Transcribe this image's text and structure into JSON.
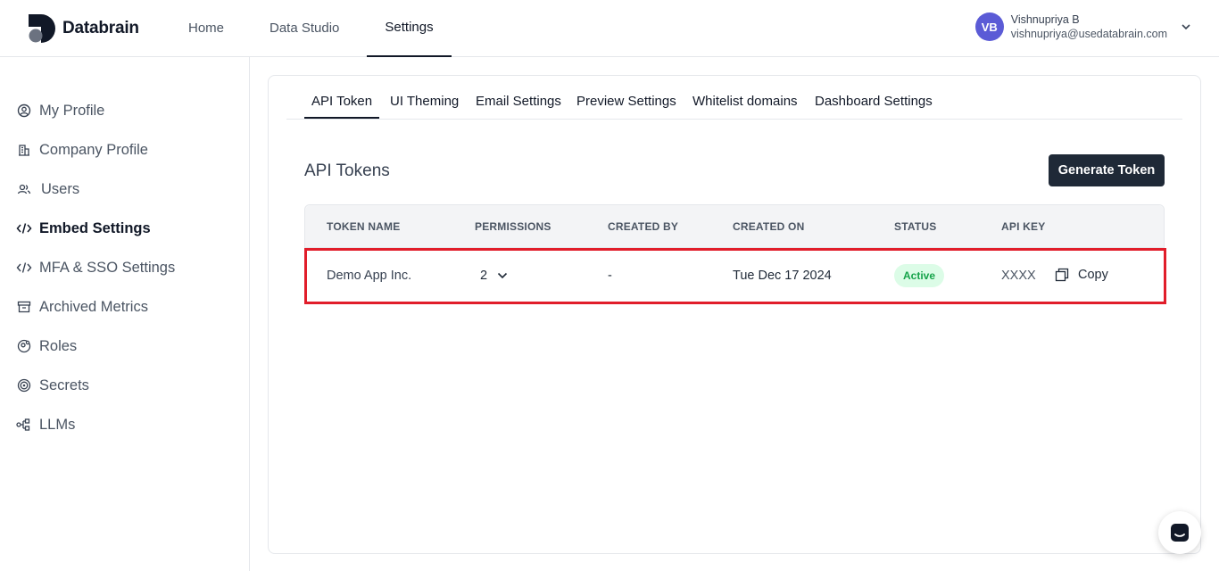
{
  "app": {
    "logo_text": "Databrain"
  },
  "topnav": [
    {
      "label": "Home"
    },
    {
      "label": "Data Studio"
    },
    {
      "label": "Settings"
    }
  ],
  "user": {
    "initials": "VB",
    "name": "Vishnupriya B",
    "email": "vishnupriya@usedatabrain.com"
  },
  "sidebar": {
    "items": [
      {
        "label": "My Profile",
        "icon": "user-circle-icon"
      },
      {
        "label": "Company Profile",
        "icon": "building-icon"
      },
      {
        "label": "Users",
        "icon": "users-icon"
      },
      {
        "label": "Embed Settings",
        "icon": "code-icon"
      },
      {
        "label": "MFA & SSO Settings",
        "icon": "code-icon"
      },
      {
        "label": "Archived Metrics",
        "icon": "archive-icon"
      },
      {
        "label": "Roles",
        "icon": "user-gear-icon"
      },
      {
        "label": "Secrets",
        "icon": "target-icon"
      },
      {
        "label": "LLMs",
        "icon": "nodes-icon"
      }
    ],
    "active": "Embed Settings"
  },
  "tabs": [
    {
      "label": "API Token"
    },
    {
      "label": "UI Theming"
    },
    {
      "label": "Email Settings"
    },
    {
      "label": "Preview Settings"
    },
    {
      "label": "Whitelist domains"
    },
    {
      "label": "Dashboard Settings"
    }
  ],
  "section": {
    "title": "API Tokens",
    "generate_label": "Generate Token"
  },
  "table": {
    "headers": [
      "TOKEN NAME",
      "PERMISSIONS",
      "CREATED BY",
      "CREATED ON",
      "STATUS",
      "API KEY"
    ],
    "rows": [
      {
        "token_name": "Demo App Inc.",
        "permissions": "2",
        "created_by": "-",
        "created_on": "Tue Dec 17 2024",
        "status": "Active",
        "api_key": "XXXX",
        "copy_label": "Copy"
      }
    ]
  },
  "colors": {
    "accent": "#1f2937",
    "avatar": "#5b5bd6",
    "active_badge_bg": "#dcfce7",
    "active_badge_text": "#16a34a",
    "highlight": "#e11d2a"
  }
}
